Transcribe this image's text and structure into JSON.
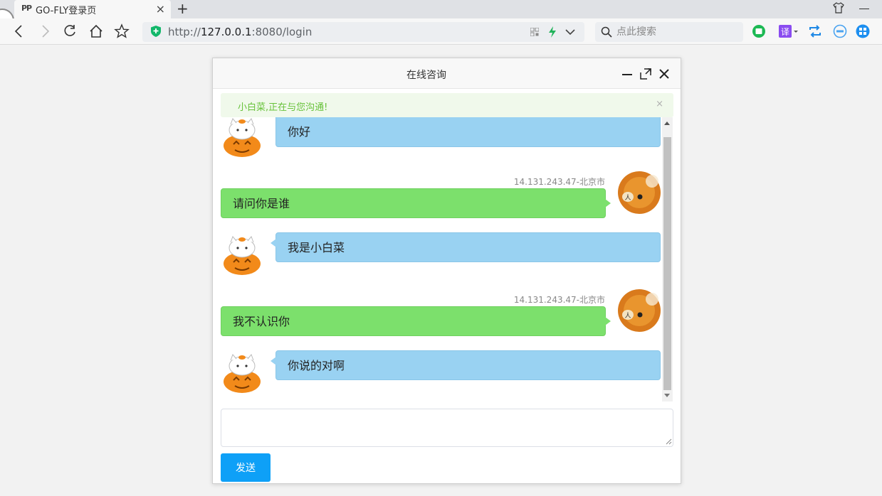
{
  "browser": {
    "tab": {
      "favicon": "PP",
      "title": "GO-FLY登录页",
      "close_label": "×"
    },
    "new_tab_label": "+",
    "address": {
      "protocol": "http://",
      "host": "127.0.0.1",
      "rest": ":8080/login"
    },
    "search_placeholder": "点此搜索"
  },
  "dialog": {
    "title": "在线咨询",
    "notice": {
      "text": "小白菜,正在与您沟通!",
      "close_label": "×"
    },
    "messages": [
      {
        "side": "service",
        "text": "你好"
      },
      {
        "side": "client",
        "meta": "14.131.243.47-北京市",
        "text": "请问你是谁"
      },
      {
        "side": "service",
        "text": "我是小白菜"
      },
      {
        "side": "client",
        "meta": "14.131.243.47-北京市",
        "text": "我不认识你"
      },
      {
        "side": "service",
        "text": "你说的对啊"
      }
    ],
    "input_value": "",
    "send_label": "发送"
  },
  "colors": {
    "service_bubble": "#99d2f2",
    "client_bubble": "#7ce06c",
    "notice_bg": "#f0f9eb",
    "notice_text": "#67c23a",
    "send_button": "#0ea0f7"
  }
}
